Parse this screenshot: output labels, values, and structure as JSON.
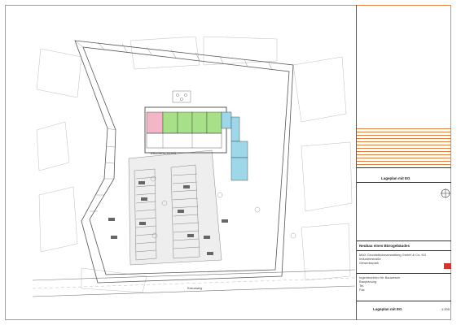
{
  "drawing": {
    "street_label": "Kreuzweg",
    "building_note": "ERDGESCHOSS"
  },
  "title_block": {
    "header_title": "Lageplan mit EG",
    "project": "Neubau eines Bürogebäudes",
    "client_lines": [
      "MAX Grundstücksverwaltung GmbH & Co. KG",
      "Industriestraße",
      "Gewerbepark"
    ],
    "architect_lines": [
      "Ingenieurbüro für Bauwesen",
      "Bauplanung",
      "Tel.",
      "Fax"
    ],
    "footer_title": "Lageplan mit EG",
    "scale": "1:200"
  },
  "colors": {
    "green_rooms": "#a8e08a",
    "pink_rooms": "#f2b6c6",
    "blue_rooms": "#9ed8e8",
    "title_lines": "#e07f3c",
    "logo_red": "#d6342a"
  }
}
